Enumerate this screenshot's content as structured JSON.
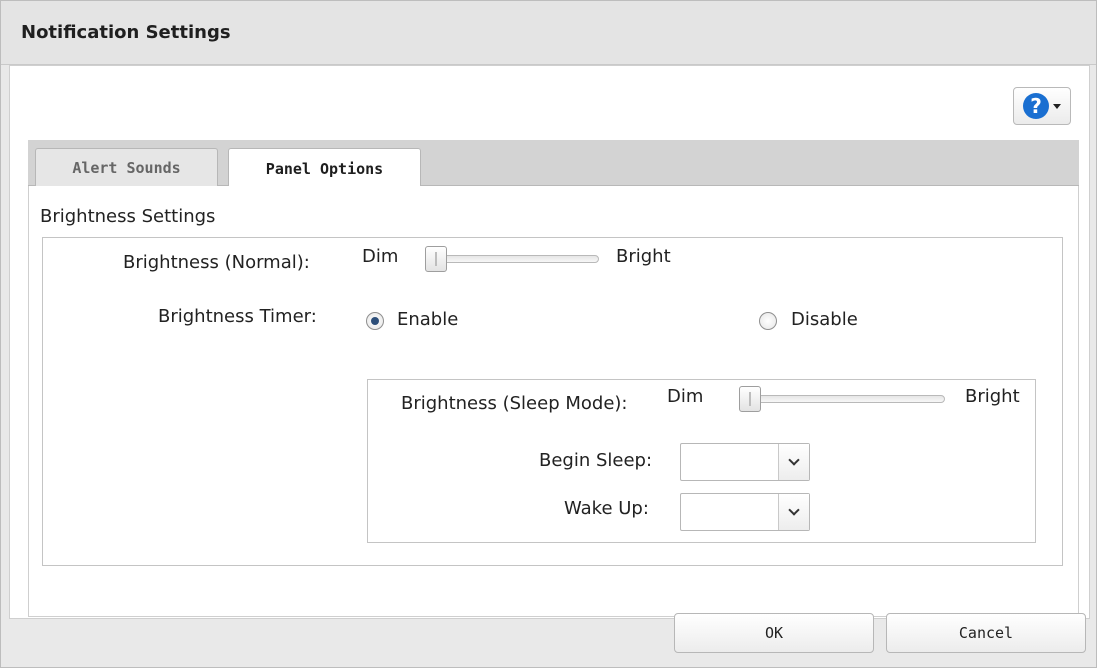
{
  "window": {
    "title": "Notification Settings"
  },
  "help": {
    "icon": "help-icon",
    "glyph": "?"
  },
  "tabs": [
    {
      "label": "Alert Sounds",
      "active": false
    },
    {
      "label": "Panel Options",
      "active": true
    }
  ],
  "section": {
    "title": "Brightness Settings"
  },
  "brightness_normal": {
    "label": "Brightness (Normal):",
    "min_label": "Dim",
    "max_label": "Bright",
    "level": 0
  },
  "brightness_timer": {
    "label": "Brightness Timer:",
    "options": [
      {
        "label": "Enable",
        "checked": true
      },
      {
        "label": "Disable",
        "checked": false
      }
    ]
  },
  "brightness_sleep": {
    "label": "Brightness (Sleep Mode):",
    "min_label": "Dim",
    "max_label": "Bright",
    "level": 0
  },
  "begin_sleep": {
    "label": "Begin Sleep:",
    "value": ""
  },
  "wake_up": {
    "label": "Wake Up:",
    "value": ""
  },
  "footer": {
    "ok_label": "OK",
    "cancel_label": "Cancel"
  },
  "colors": {
    "help_blue": "#1a6fd1",
    "radio_dot": "#2d4f7a"
  }
}
